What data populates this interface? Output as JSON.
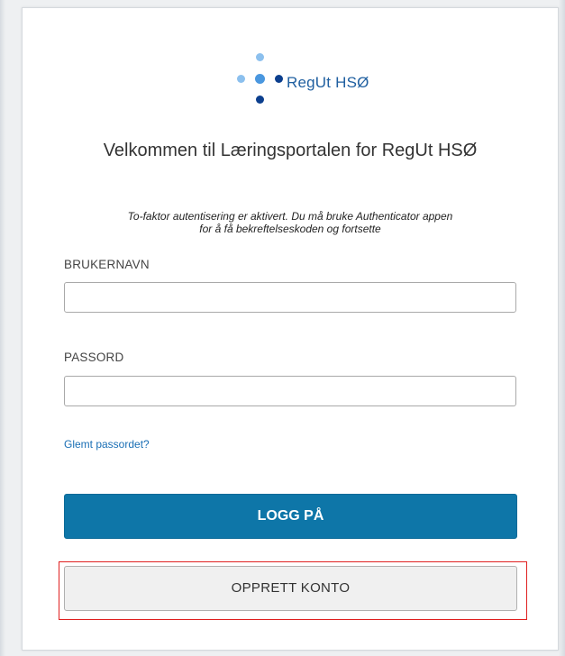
{
  "brand": {
    "name": "RegUt HSØ",
    "dot_colors": {
      "light": "#8cc0ee",
      "medium": "#4a97df",
      "dark": "#0c3f8e"
    }
  },
  "login": {
    "title": "Velkommen til Læringsportalen for RegUt HSØ",
    "subtitle_line1": "To-faktor autentisering er aktivert. Du må bruke Authenticator appen",
    "subtitle_line2": "for å få bekreftelseskoden og fortsette",
    "username_label": "BRUKERNAVN",
    "username_value": "",
    "password_label": "PASSORD",
    "password_value": "",
    "forgot_link": "Glemt passordet?",
    "login_button": "LOGG PÅ",
    "create_account_button": "OPPRETT KONTO"
  },
  "colors": {
    "primary": "#0e76a8",
    "link": "#1a6fb5",
    "highlight": "#e02020"
  }
}
